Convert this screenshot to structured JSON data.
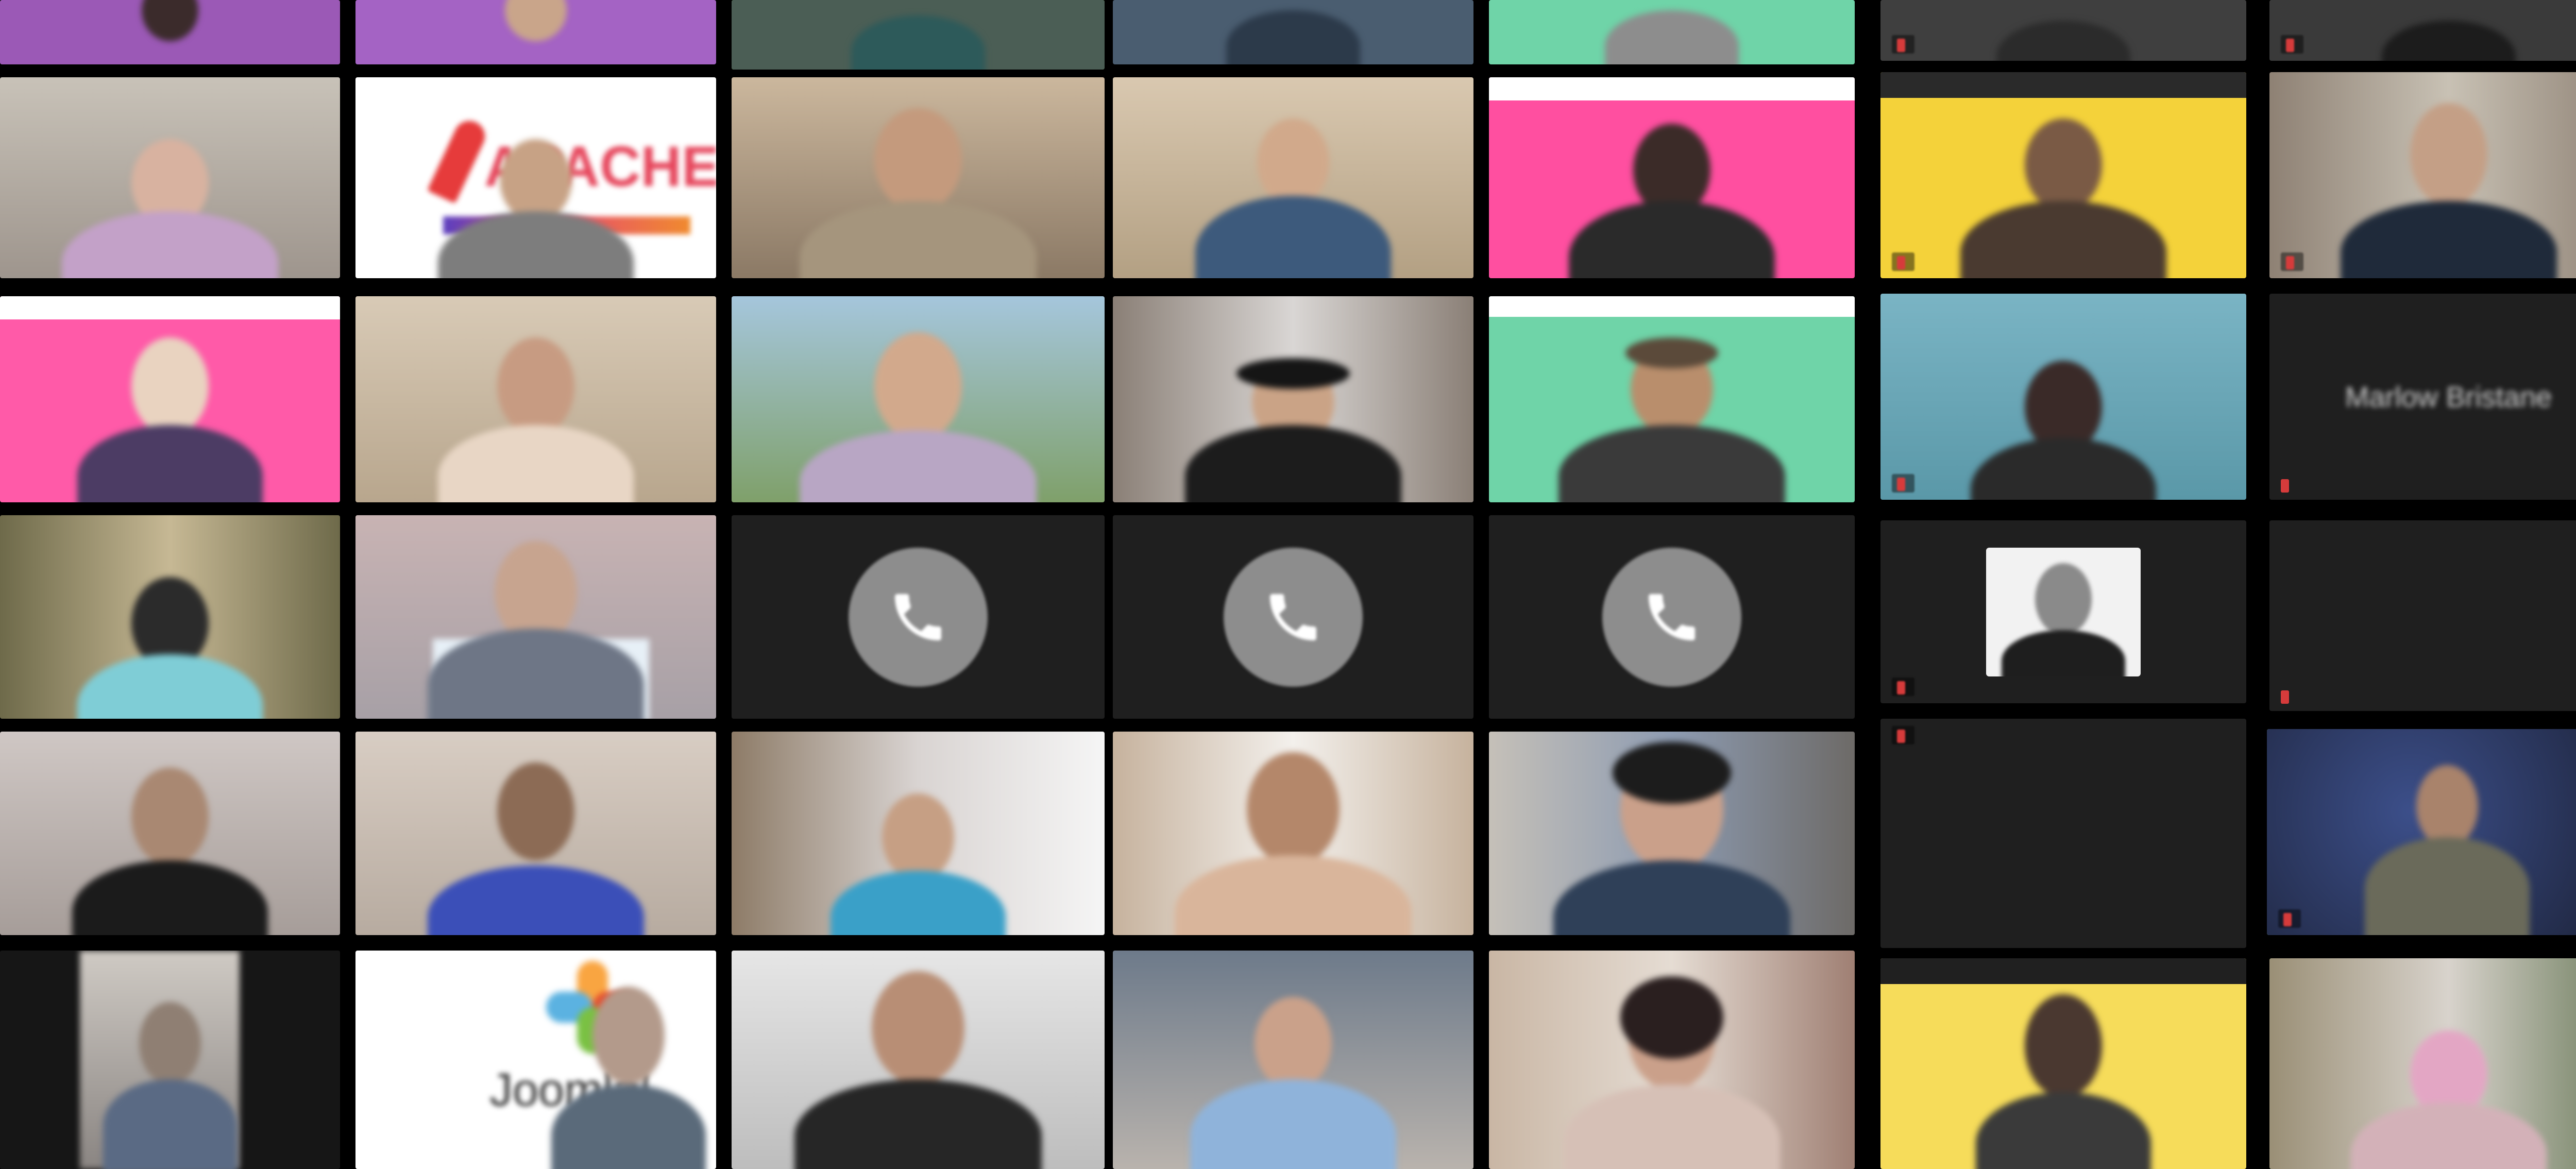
{
  "meeting": {
    "participants": [
      {
        "name": "",
        "bg": "#9b59b6"
      },
      {
        "name": "",
        "bg": "#a463c4"
      },
      {
        "name": "",
        "bg": "#7c8b7a"
      },
      {
        "name": "",
        "bg": "#4a5d70"
      },
      {
        "name": "",
        "bg": "#6fd4a8"
      },
      {
        "name": "",
        "bg": "#b8b0a4"
      },
      {
        "name": "",
        "bg": "#ffffff",
        "logo": "APACHE"
      },
      {
        "name": "",
        "bg": "#9a8e7a"
      },
      {
        "name": "",
        "bg": "#cbb99c"
      },
      {
        "name": "",
        "bg": "#ff4fa0"
      },
      {
        "name": "",
        "bg": "#ff5aa8"
      },
      {
        "name": "",
        "bg": "#cfc2ad"
      },
      {
        "name": "",
        "bg": "#7fa06a"
      },
      {
        "name": "",
        "bg": "#8a7f76"
      },
      {
        "name": "",
        "bg": "#6fd4a8"
      },
      {
        "name": "",
        "bg": "#8b8a63"
      },
      {
        "name": "",
        "bg": "#bfaeb0"
      },
      {
        "name": "",
        "bg": "#cfc7c4"
      },
      {
        "name": "",
        "bg": "#b5aca2"
      },
      {
        "name": "",
        "bg": "#d9d4d2"
      },
      {
        "name": "",
        "bg": "#e8e8e8"
      },
      {
        "name": "",
        "bg": "#c5c0b8"
      },
      {
        "name": "",
        "bg": "#ffffff",
        "logo": "Joomla!"
      },
      {
        "name": "",
        "bg": "#bdbdbd"
      },
      {
        "name": "",
        "bg": "#6d7a8a"
      },
      {
        "name": "",
        "bg": "#c9b6a4"
      }
    ],
    "right_panel": [
      {
        "name": "",
        "bg": "#3f3f3f"
      },
      {
        "name": "",
        "bg": "#3a3a3a"
      },
      {
        "name": "",
        "bg": "#f4d23a"
      },
      {
        "name": "",
        "bg": "#8e8174"
      },
      {
        "name": "",
        "bg": "#6ca6b7"
      },
      {
        "name": "Marlow Bristane",
        "bg": "#1f1f1f"
      },
      {
        "name": "",
        "bg": "#1f1f1f"
      },
      {
        "name": "",
        "bg": "#1f1f1f"
      },
      {
        "name": "",
        "bg": "#1f1f1f"
      },
      {
        "name": "",
        "bg": "#2b3450"
      },
      {
        "name": "",
        "bg": "#f6dc5a"
      },
      {
        "name": "",
        "bg": "#9a8f76"
      }
    ]
  },
  "colors": {
    "active_speaker": "#8bd34c",
    "muted_mic": "#d63b3b",
    "phone_circle": "#8d8d8d"
  }
}
